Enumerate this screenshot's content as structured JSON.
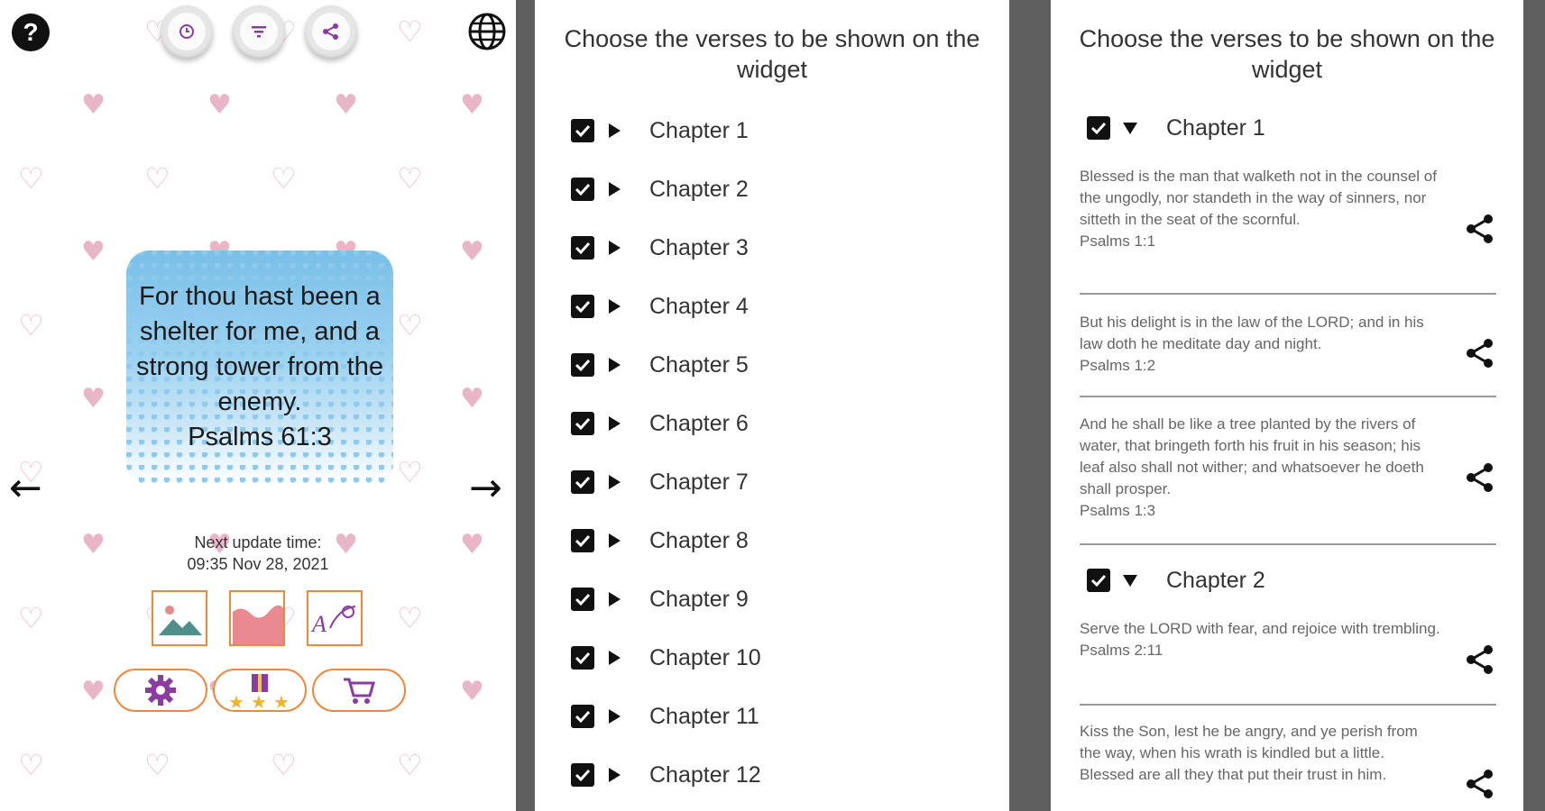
{
  "left_panel": {
    "help_icon": "question-circle-icon",
    "toolbar": [
      "refresh-icon",
      "filter-icon",
      "share-icon"
    ],
    "globe_icon": "globe-icon",
    "quote": {
      "text": "For thou hast been a shelter for me, and a strong tower from the enemy.",
      "reference": "Psalms 61:3"
    },
    "next_update": {
      "label": "Next update time:",
      "value": "09:35 Nov 28, 2021"
    },
    "image_buttons": [
      "landscape-image-icon",
      "wave-background-icon",
      "text-style-icon"
    ],
    "action_buttons": [
      "gear-icon",
      "gift-rating-icon",
      "cart-icon"
    ],
    "colors": {
      "accent_orange": "#f0883c",
      "heart_pink": "#e9b6c8",
      "purple": "#8a3ca0"
    }
  },
  "middle_panel": {
    "title": "Choose the verses to be shown on the widget",
    "chapters": [
      {
        "label": "Chapter 1",
        "checked": true
      },
      {
        "label": "Chapter 2",
        "checked": true
      },
      {
        "label": "Chapter 3",
        "checked": true
      },
      {
        "label": "Chapter 4",
        "checked": true
      },
      {
        "label": "Chapter 5",
        "checked": true
      },
      {
        "label": "Chapter 6",
        "checked": true
      },
      {
        "label": "Chapter 7",
        "checked": true
      },
      {
        "label": "Chapter 8",
        "checked": true
      },
      {
        "label": "Chapter 9",
        "checked": true
      },
      {
        "label": "Chapter 10",
        "checked": true
      },
      {
        "label": "Chapter 11",
        "checked": true
      },
      {
        "label": "Chapter 12",
        "checked": true
      }
    ]
  },
  "right_panel": {
    "title": "Choose the verses to be shown on the widget",
    "chapter1": "Chapter 1",
    "chapter2": "Chapter 2",
    "verses": [
      {
        "text": "Blessed is the man that walketh not in the counsel of the ungodly, nor standeth in the way of sinners, nor sitteth in the seat of the scornful.",
        "ref": "Psalms 1:1"
      },
      {
        "text": "But his delight is in the law of the LORD; and in his law doth he meditate day and night.",
        "ref": "Psalms 1:2"
      },
      {
        "text": "And he shall be like a tree planted by the rivers of water, that bringeth forth his fruit in his season; his leaf also shall not wither; and whatsoever he doeth shall prosper.",
        "ref": "Psalms 1:3"
      },
      {
        "text": "Serve the LORD with fear, and rejoice with trembling.",
        "ref": "Psalms 2:11"
      },
      {
        "text": "Kiss the Son, lest he be angry, and ye perish from the way, when his wrath is kindled but a little. Blessed are all they that put their trust in him.",
        "ref": ""
      }
    ]
  }
}
